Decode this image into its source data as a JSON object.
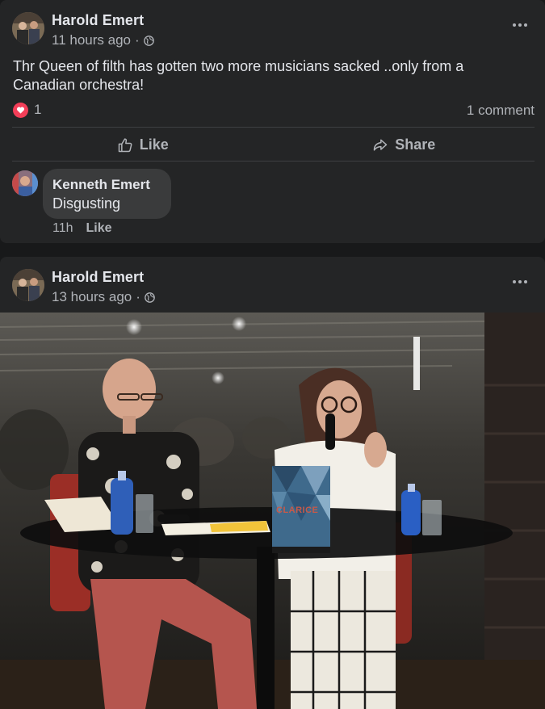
{
  "posts": [
    {
      "author": "Harold Emert",
      "time": "11 hours ago",
      "separator": "·",
      "privacy_icon": "globe-icon",
      "text": "Thr Queen of filth has gotten two more musicians sacked ..only from a Canadian orchestra!",
      "reaction_icon": "heart-icon",
      "reaction_count": "1",
      "comment_count_label": "1 comment",
      "actions": {
        "like": "Like",
        "share": "Share"
      },
      "comments": [
        {
          "author": "Kenneth Emert",
          "text": "Disgusting",
          "time": "11h",
          "like_label": "Like"
        }
      ]
    },
    {
      "author": "Harold Emert",
      "time": "13 hours ago",
      "separator": "·",
      "privacy_icon": "globe-icon",
      "photo": {
        "book_title": "CLARICE"
      }
    }
  ],
  "colors": {
    "background": "#18191a",
    "card": "#242526",
    "bubble": "#3a3b3c",
    "primary_text": "#e4e6eb",
    "secondary_text": "#b0b3b8",
    "love_reaction": "#f33e58"
  }
}
